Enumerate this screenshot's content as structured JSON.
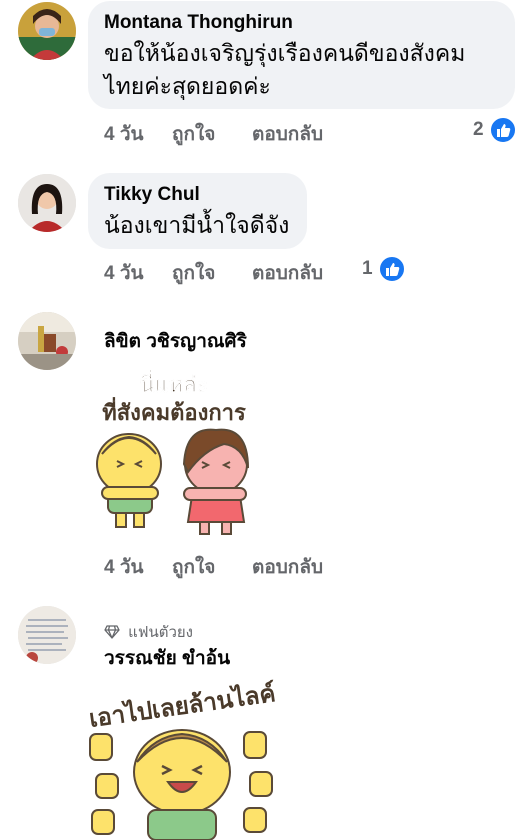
{
  "comments": [
    {
      "author": "Montana Thonghirun",
      "text_line1": "ขอให้น้องเจริญรุ่งเรืองคนดีของสังคม",
      "text_line2": "ไทยค่ะสุดยอดค่ะ",
      "time": "4 วัน",
      "like_label": "ถูกใจ",
      "reply_label": "ตอบกลับ",
      "reaction_count": "2"
    },
    {
      "author": "Tikky Chul",
      "text_line1": "น้องเขามีน้ำใจดีจัง",
      "time": "4 วัน",
      "like_label": "ถูกใจ",
      "reply_label": "ตอบกลับ",
      "reaction_count": "1"
    },
    {
      "author": "ลิขิต วชิรญาณศิริ",
      "sticker_text_line1": "นี่แหล่ะ",
      "sticker_text_line2": "ที่สังคมต้องการ",
      "time": "4 วัน",
      "like_label": "ถูกใจ",
      "reply_label": "ตอบกลับ"
    },
    {
      "badge": "แฟนตัวยง",
      "author": "วรรณชัย ขำอ้น",
      "sticker_text": "เอาไปเลยล้านไลค์"
    }
  ],
  "colors": {
    "bubble": "#f0f2f5",
    "meta": "#65676b",
    "like_blue": "#1877f2",
    "sticker_yellow": "#fde26b",
    "sticker_green": "#8cc98a",
    "sticker_pink": "#f58c95"
  }
}
